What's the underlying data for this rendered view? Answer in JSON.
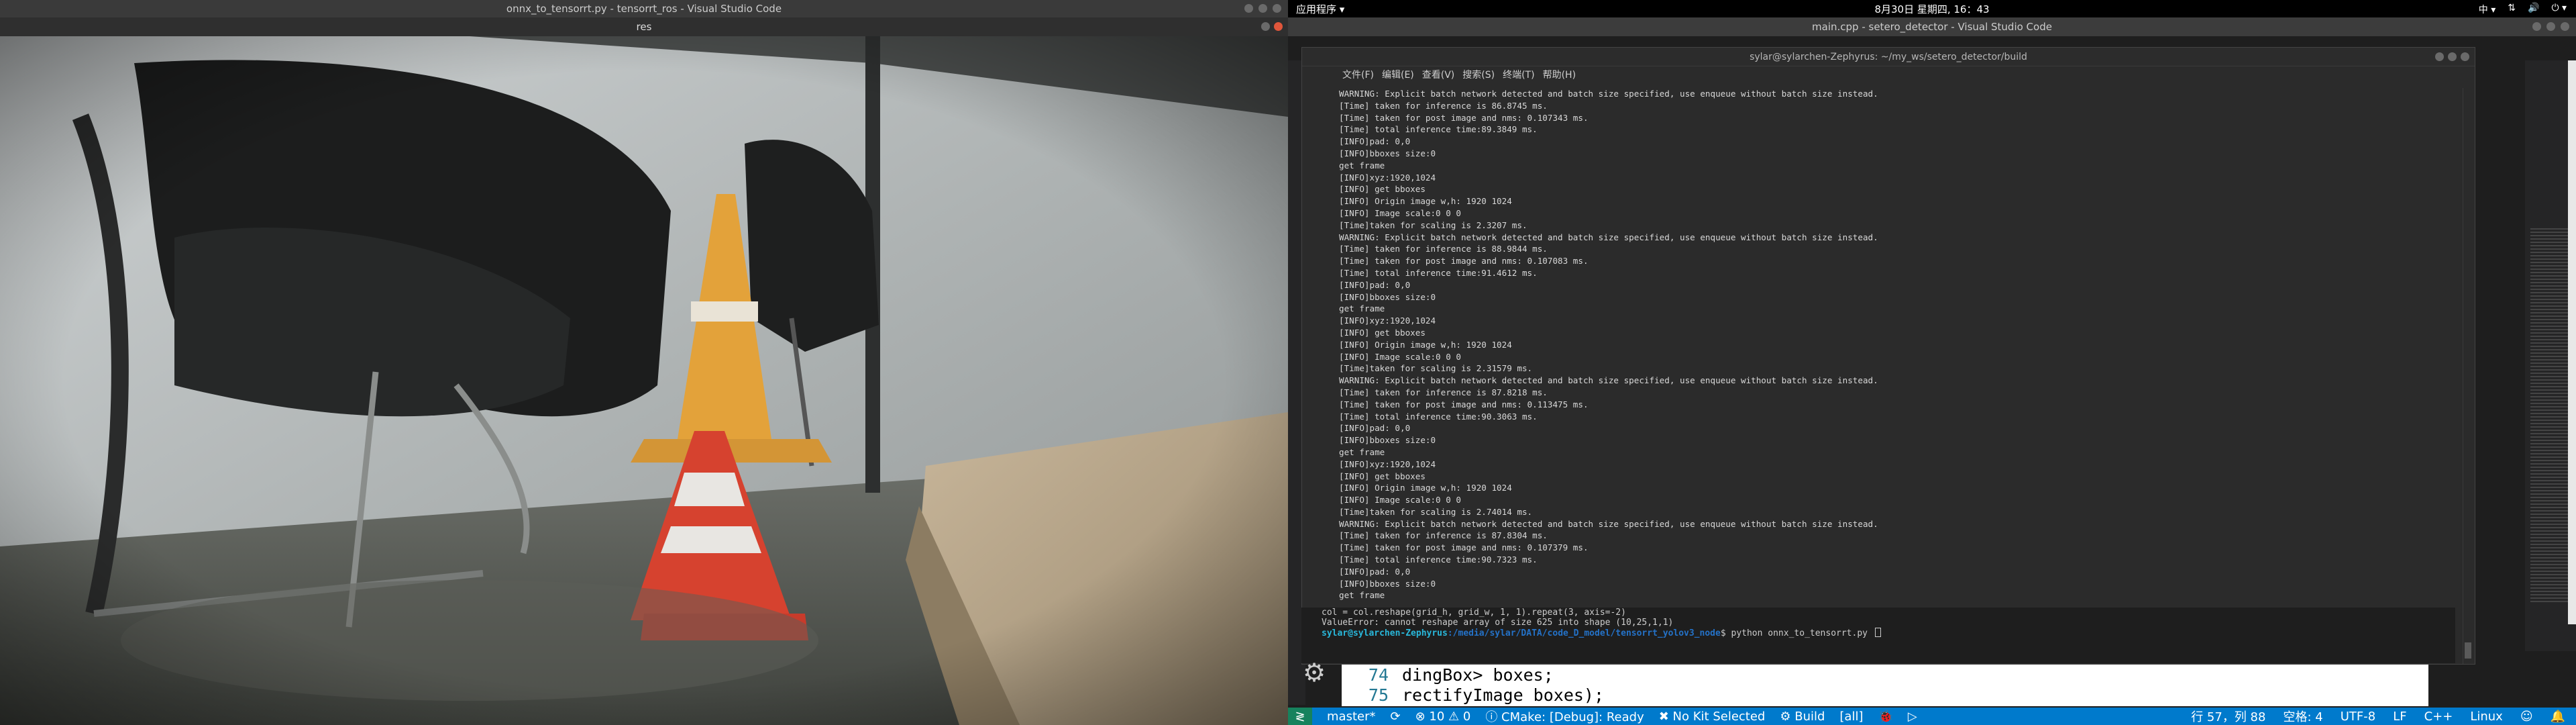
{
  "left": {
    "vscode_title": "onnx_to_tensorrt.py - tensorrt_ros - Visual Studio Code",
    "res_title": "res"
  },
  "right": {
    "topbar": {
      "apps_menu": "应用程序 ▾",
      "clock": "8月30日 星期四, 16：43",
      "indicators": [
        "中 ▾",
        "⇅",
        "🔊",
        "⏻ ▾"
      ]
    },
    "vscode_title": "main.cpp - setero_detector - Visual Studio Code",
    "terminal": {
      "title": "sylar@sylarchen-Zephyrus: ~/my_ws/setero_detector/build",
      "menu": [
        "文件(F)",
        "编辑(E)",
        "查看(V)",
        "搜索(S)",
        "终端(T)",
        "帮助(H)"
      ],
      "lines": [
        "WARNING: Explicit batch network detected and batch size specified, use enqueue without batch size instead.",
        "[Time] taken for inference is 86.8745 ms.",
        "[Time] taken for post image and nms: 0.107343 ms.",
        "[Time] total inference time:89.3849 ms.",
        "[INFO]pad: 0,0",
        "[INFO]bboxes size:0",
        "get frame",
        "[INFO]xyz:1920,1024",
        "[INFO] get bboxes",
        "[INFO] Origin image w,h: 1920 1024",
        "[INFO] Image scale:0 0 0",
        "[Time]taken for scaling is 2.3207 ms.",
        "WARNING: Explicit batch network detected and batch size specified, use enqueue without batch size instead.",
        "[Time] taken for inference is 88.9844 ms.",
        "[Time] taken for post image and nms: 0.107083 ms.",
        "[Time] total inference time:91.4612 ms.",
        "[INFO]pad: 0,0",
        "[INFO]bboxes size:0",
        "get frame",
        "[INFO]xyz:1920,1024",
        "[INFO] get bboxes",
        "[INFO] Origin image w,h: 1920 1024",
        "[INFO] Image scale:0 0 0",
        "[Time]taken for scaling is 2.31579 ms.",
        "WARNING: Explicit batch network detected and batch size specified, use enqueue without batch size instead.",
        "[Time] taken for inference is 87.8218 ms.",
        "[Time] taken for post image and nms: 0.113475 ms.",
        "[Time] total inference time:90.3063 ms.",
        "[INFO]pad: 0,0",
        "[INFO]bboxes size:0",
        "get frame",
        "[INFO]xyz:1920,1024",
        "[INFO] get bboxes",
        "[INFO] Origin image w,h: 1920 1024",
        "[INFO] Image scale:0 0 0",
        "[Time]taken for scaling is 2.74014 ms.",
        "WARNING: Explicit batch network detected and batch size specified, use enqueue without batch size instead.",
        "[Time] taken for inference is 87.8304 ms.",
        "[Time] taken for post image and nms: 0.107379 ms.",
        "[Time] total inference time:90.7323 ms.",
        "[INFO]pad: 0,0",
        "[INFO]bboxes size:0",
        "get frame"
      ]
    },
    "panel": {
      "line1": "col = col.reshape(grid_h, grid_w, 1, 1).repeat(3, axis=-2)",
      "line2": "ValueError: cannot reshape array of size 625 into shape (10,25,1,1)",
      "prompt_user": "sylar@sylarchen-Zephyrus",
      "prompt_path": ":/media/sylar/DATA/code_D_model/tensorrt_yolov3_node",
      "prompt_cmd": "$ python onnx_to_tensorrt.py "
    },
    "code": [
      {
        "ln": "74",
        "text": "dingBox> boxes;"
      },
      {
        "ln": "75",
        "text": "rectifyImage boxes);"
      }
    ],
    "statusbar": {
      "remote": "≷",
      "branch": "master*",
      "sync": "⟳",
      "problems": "⊗ 10 ⚠ 0",
      "cmake": "ⓘ CMake: [Debug]: Ready",
      "kit": "✖ No Kit Selected",
      "build": "⚙ Build",
      "target": "[all]",
      "bug": "🐞",
      "run": "▷",
      "position": "行 57，列 88",
      "spaces": "空格: 4",
      "encoding": "UTF-8",
      "eol": "LF",
      "language": "C++",
      "os": "Linux",
      "feedback": "☺",
      "bell": "🔔"
    },
    "side_letters": [
      "3",
      "[I",
      "Loa",
      "Beg",
      "Com",
      "Bui",
      "Com",
      "[Te",
      "Run",
      "Tra",
      "Val",
      "syl",
      "[s:",
      "syl",
      "3",
      "[I",
      "Loa",
      "Beg",
      "Com",
      "Bui",
      "Com",
      "[Te",
      "Run",
      "Tra"
    ]
  }
}
